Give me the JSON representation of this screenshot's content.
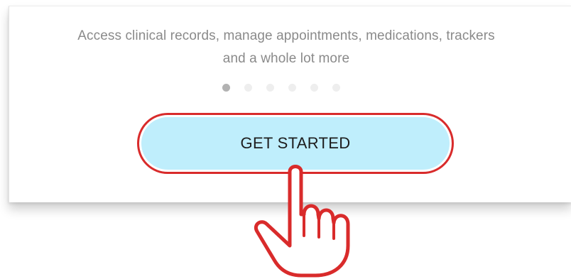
{
  "onboarding": {
    "description_line1": "Access clinical records, manage appointments, medications, trackers",
    "description_line2": "and a whole lot more",
    "pager": {
      "total_pages": 6,
      "current_page": 1
    },
    "cta_label": "GET STARTED"
  },
  "colors": {
    "button_fill": "#bfeefc",
    "highlight_outline": "#d92b2b",
    "text_muted": "#8a8a8a"
  },
  "icons": {
    "pointer": "hand-pointer-icon"
  }
}
